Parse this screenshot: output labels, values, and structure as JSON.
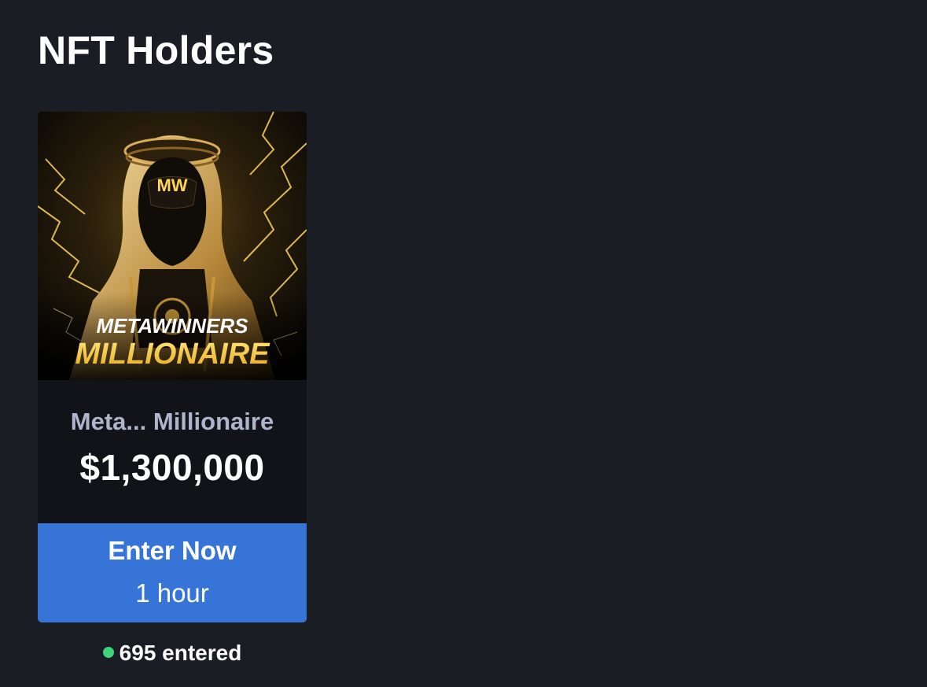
{
  "page": {
    "title": "NFT Holders"
  },
  "card": {
    "image_text_line1": "METAWINNERS",
    "image_text_line2": "MILLIONAIRE",
    "image_logo": "MW",
    "title": "Meta... Millionaire",
    "prize": "$1,300,000",
    "button_label": "Enter Now",
    "time_remaining": "1 hour",
    "entered_text": "695 entered",
    "status_icon": "green-dot-icon"
  },
  "colors": {
    "background": "#1b1d25",
    "card_background": "#111318",
    "button": "#3774d8",
    "title_gray": "#aeb4cb",
    "gold": "#f1c84c",
    "status_green": "#3fd47a"
  }
}
